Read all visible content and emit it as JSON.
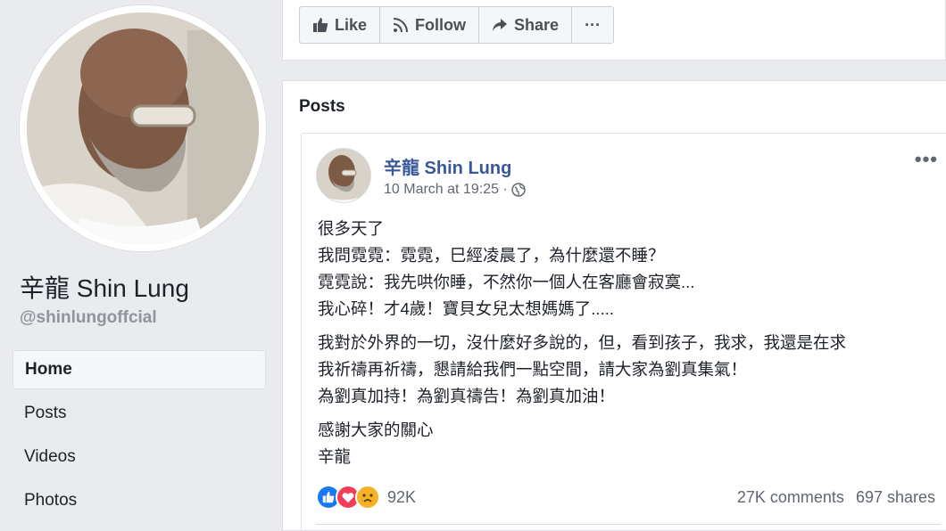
{
  "profile": {
    "name": "辛龍 Shin Lung",
    "handle": "@shinlungoffcial"
  },
  "nav": {
    "items": [
      {
        "label": "Home",
        "active": true
      },
      {
        "label": "Posts",
        "active": false
      },
      {
        "label": "Videos",
        "active": false
      },
      {
        "label": "Photos",
        "active": false
      }
    ]
  },
  "actions": {
    "like_label": "Like",
    "follow_label": "Follow",
    "share_label": "Share",
    "more_label": "···"
  },
  "posts": {
    "title": "Posts",
    "post": {
      "author": "辛龍 Shin Lung",
      "timestamp": "10 March at 19:25 ·",
      "privacy_icon": "globe-icon",
      "more_label": "•••",
      "paragraphs": [
        [
          "很多天了",
          "我問霓霓：霓霓，巳經凌晨了，為什麼還不睡？",
          "霓霓說：我先哄你睡，不然你一個人在客廳會寂寞...",
          "我心碎！才4歲！寶貝女兒太想媽媽了....."
        ],
        [
          "我對於外界的一切，沒什麼好多說的，但，看到孩子，我求，我還是在求",
          "我祈禱再祈禱，懇請給我們一點空間，請大家為劉真集氣！",
          "為劉真加持！為劉真禱告！為劉真加油！"
        ],
        [
          "感謝大家的關心",
          "辛龍"
        ]
      ],
      "reactions": {
        "icons": [
          "like-reaction-icon",
          "love-reaction-icon",
          "sad-reaction-icon"
        ],
        "count": "92K"
      },
      "comments": "27K comments",
      "shares": "697 shares"
    }
  },
  "colors": {
    "page_bg": "#e9ebee",
    "link_blue": "#385898",
    "like_blue": "#1877f2",
    "love_red": "#f33e58",
    "sad_yellow": "#f7b125"
  }
}
